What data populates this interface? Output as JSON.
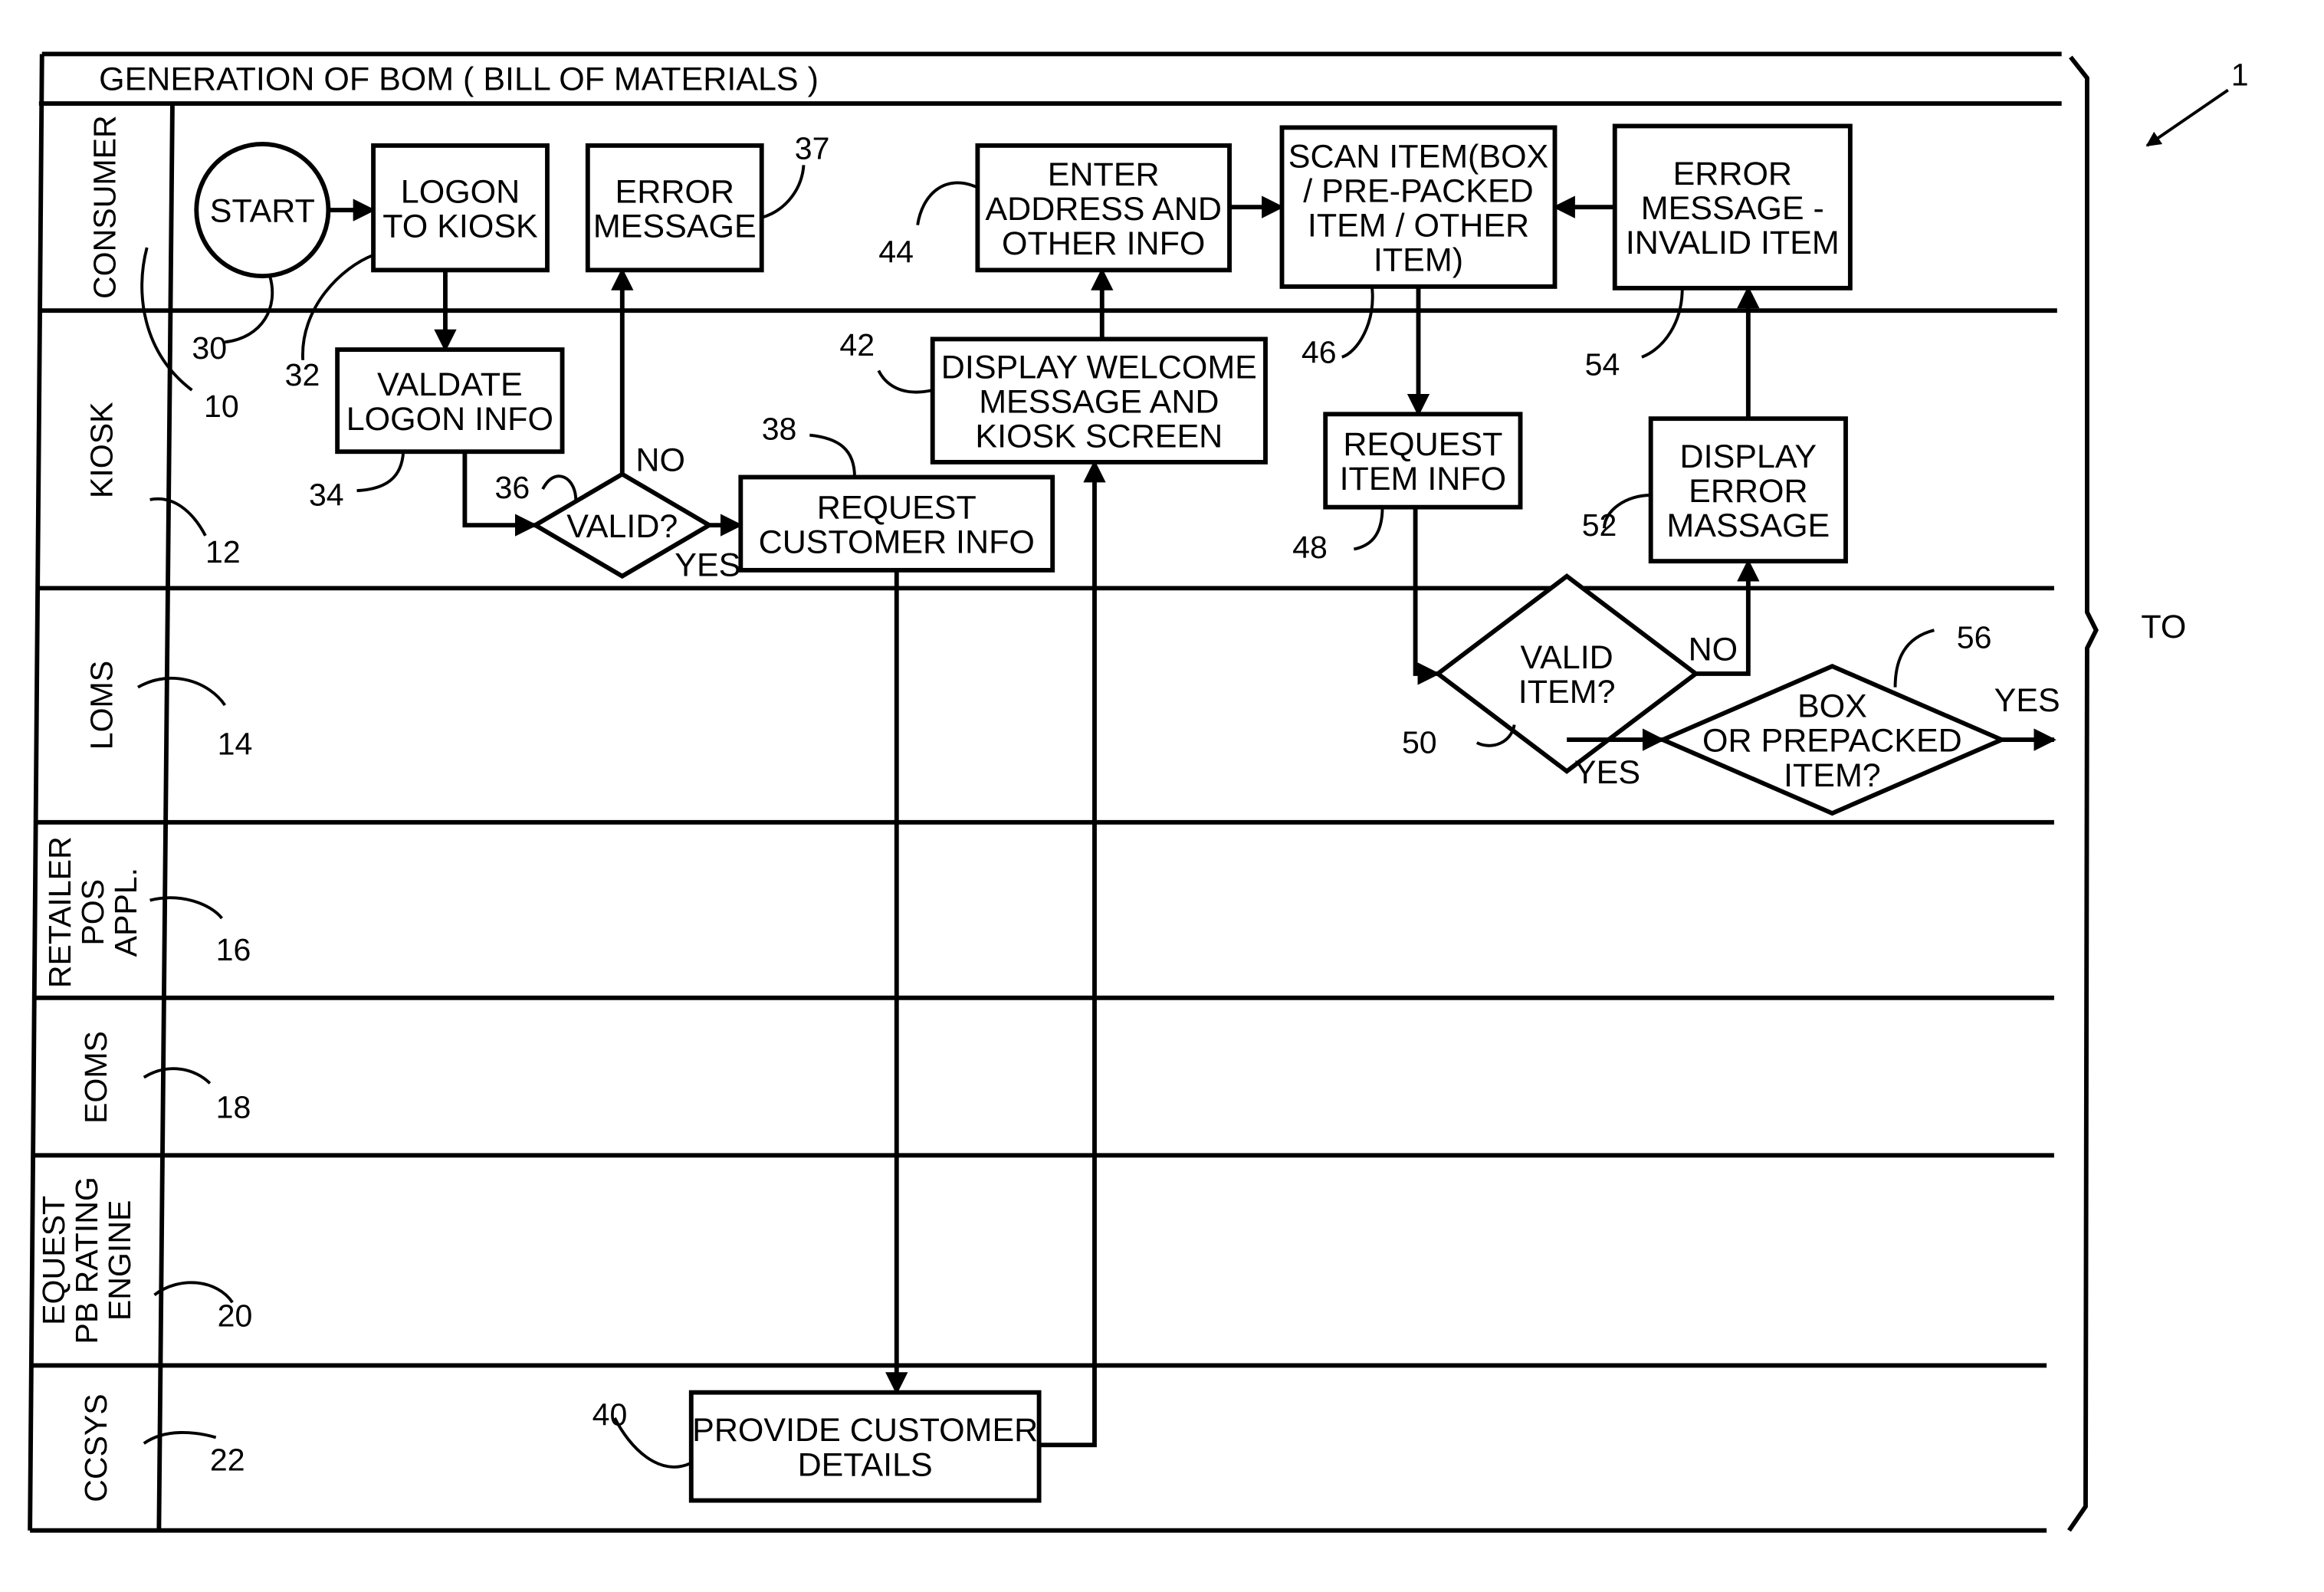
{
  "title": "GENERATION OF BOM ( BILL OF MATERIALS )",
  "figure_ref": "1",
  "continuation_label": "TO",
  "lanes": [
    {
      "label": [
        "CONSUMER"
      ],
      "ref": "10"
    },
    {
      "label": [
        "KIOSK"
      ],
      "ref": "12"
    },
    {
      "label": [
        "LOMS"
      ],
      "ref": "14"
    },
    {
      "label": [
        "RETAILER",
        "POS",
        "APPL."
      ],
      "ref": "16"
    },
    {
      "label": [
        "EOMS"
      ],
      "ref": "18"
    },
    {
      "label": [
        "EQUEST",
        "PB RATING",
        "ENGINE"
      ],
      "ref": "20"
    },
    {
      "label": [
        "CCSYS"
      ],
      "ref": "22"
    }
  ],
  "nodes": {
    "start": {
      "type": "terminal",
      "lines": [
        "START"
      ],
      "ref": "30"
    },
    "logon": {
      "type": "process",
      "lines": [
        "LOGON",
        "TO KIOSK"
      ],
      "ref": "32"
    },
    "error_message": {
      "type": "process",
      "lines": [
        "ERROR",
        "MESSAGE"
      ],
      "ref": "37"
    },
    "validate_logon": {
      "type": "process",
      "lines": [
        "VALDATE",
        "LOGON INFO"
      ],
      "ref": "34"
    },
    "valid_decision": {
      "type": "decision",
      "lines": [
        "VALID?"
      ],
      "ref": "36"
    },
    "request_customer": {
      "type": "process",
      "lines": [
        "REQUEST",
        "CUSTOMER INFO"
      ],
      "ref": "38"
    },
    "provide_customer": {
      "type": "process",
      "lines": [
        "PROVIDE CUSTOMER",
        "DETAILS"
      ],
      "ref": "40"
    },
    "display_welcome": {
      "type": "process",
      "lines": [
        "DISPLAY WELCOME",
        "MESSAGE AND",
        "KIOSK SCREEN"
      ],
      "ref": "42"
    },
    "enter_address": {
      "type": "process",
      "lines": [
        "ENTER",
        "ADDRESS AND",
        "OTHER INFO"
      ],
      "ref": "44"
    },
    "scan_item": {
      "type": "process",
      "lines": [
        "SCAN ITEM(BOX",
        "/ PRE-PACKED",
        "ITEM / OTHER",
        "ITEM)"
      ],
      "ref": "46"
    },
    "request_item": {
      "type": "process",
      "lines": [
        "REQUEST",
        "ITEM INFO"
      ],
      "ref": "48"
    },
    "valid_item_decision": {
      "type": "decision",
      "lines": [
        "VALID",
        "ITEM?"
      ],
      "ref": "50"
    },
    "display_error": {
      "type": "process",
      "lines": [
        "DISPLAY",
        "ERROR",
        "MASSAGE"
      ],
      "ref": "52"
    },
    "error_invalid_item": {
      "type": "process",
      "lines": [
        "ERROR",
        "MESSAGE -",
        "INVALID ITEM"
      ],
      "ref": "54"
    },
    "box_decision": {
      "type": "decision",
      "lines": [
        "BOX",
        "OR PREPACKED",
        "ITEM?"
      ],
      "ref": "56"
    }
  },
  "edge_labels": {
    "valid_no": "NO",
    "valid_yes": "YES",
    "valid_item_no": "NO",
    "valid_item_yes": "YES",
    "box_yes": "YES"
  }
}
